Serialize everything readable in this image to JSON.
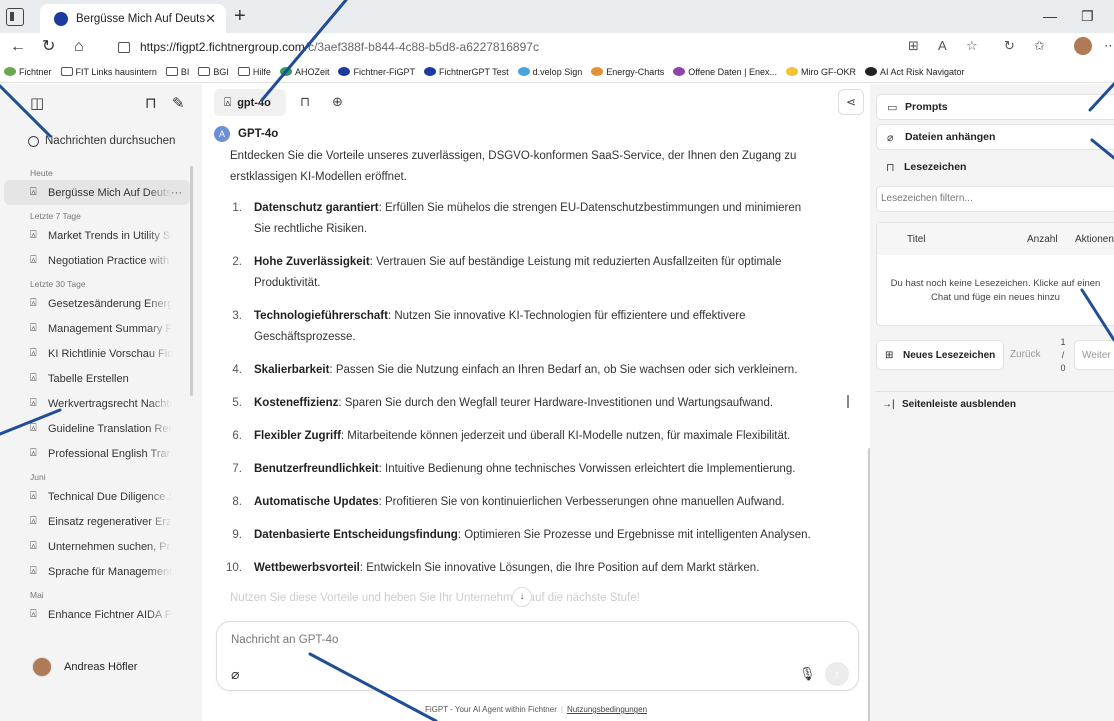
{
  "browser": {
    "tab_title": "Bergüsse Mich Auf Deutsch",
    "url_host": "https://figpt2.fichtnergroup.com",
    "url_path": "/c/3aef388f-b844-4c88-b5d8-a6227816897c"
  },
  "bookmarks": [
    {
      "label": "Fichtner",
      "color": "#6aa84f"
    },
    {
      "label": "FIT Links hausintern",
      "color": ""
    },
    {
      "label": "BI",
      "color": ""
    },
    {
      "label": "BGI",
      "color": ""
    },
    {
      "label": "Hilfe",
      "color": ""
    },
    {
      "label": "AHOZeit",
      "color": "#2e9c5c"
    },
    {
      "label": "Fichtner-FiGPT",
      "color": "#1d3b9e"
    },
    {
      "label": "FichtnerGPT Test",
      "color": "#1d3b9e"
    },
    {
      "label": "d.velop Sign",
      "color": "#4aa3df"
    },
    {
      "label": "Energy-Charts",
      "color": "#e69138"
    },
    {
      "label": "Offene Daten | Enex...",
      "color": "#8e44ad"
    },
    {
      "label": "Miro GF-OKR",
      "color": "#f1c232"
    },
    {
      "label": "AI Act Risk Navigator",
      "color": "#222222"
    }
  ],
  "sidebar": {
    "search_placeholder": "Nachrichten durchsuchen",
    "groups": [
      {
        "label": "Heute",
        "items": [
          {
            "title": "Bergüsse Mich Auf Deutsch",
            "active": true
          }
        ]
      },
      {
        "label": "Letzte 7 Tage",
        "items": [
          {
            "title": "Market Trends in Utility Sector"
          },
          {
            "title": "Negotiation Practice with AI"
          }
        ]
      },
      {
        "label": "Letzte 30 Tage",
        "items": [
          {
            "title": "Gesetzesänderung Energiewende"
          },
          {
            "title": "Management Summary Fichtner"
          },
          {
            "title": "KI Richtlinie Vorschau Fichtner"
          },
          {
            "title": "Tabelle Erstellen"
          },
          {
            "title": "Werkvertragsrecht Nachteile"
          },
          {
            "title": "Guideline Translation Request"
          },
          {
            "title": "Professional English Translation"
          }
        ]
      },
      {
        "label": "Juni",
        "items": [
          {
            "title": "Technical Due Diligence Struktur"
          },
          {
            "title": "Einsatz regenerativer Erzeugung"
          },
          {
            "title": "Unternehmen suchen, Präsentation"
          },
          {
            "title": "Sprache für Management Summary"
          }
        ]
      },
      {
        "label": "Mai",
        "items": [
          {
            "title": "Enhance Fichtner AIDA Product"
          }
        ]
      }
    ],
    "user_name": "Andreas Höfler"
  },
  "main": {
    "model_label": "gpt-4o",
    "assistant_name": "GPT-4o",
    "intro": "Entdecken Sie die Vorteile unseres zuverlässigen, DSGVO-konformen SaaS-Service, der Ihnen den Zugang zu erstklassigen KI-Modellen eröffnet.",
    "points": [
      {
        "n": "1.",
        "title": "Datenschutz garantiert",
        "text": ": Erfüllen Sie mühelos die strengen EU-Datenschutzbestimmungen und minimieren Sie rechtliche Risiken."
      },
      {
        "n": "2.",
        "title": "Hohe Zuverlässigkeit",
        "text": ": Vertrauen Sie auf beständige Leistung mit reduzierten Ausfallzeiten für optimale Produktivität."
      },
      {
        "n": "3.",
        "title": "Technologieführerschaft",
        "text": ": Nutzen Sie innovative KI-Technologien für effizientere und effektivere Geschäftsprozesse."
      },
      {
        "n": "4.",
        "title": "Skalierbarkeit",
        "text": ": Passen Sie die Nutzung einfach an Ihren Bedarf an, ob Sie wachsen oder sich verkleinern."
      },
      {
        "n": "5.",
        "title": "Kosteneffizienz",
        "text": ": Sparen Sie durch den Wegfall teurer Hardware-Investitionen und Wartungsaufwand."
      },
      {
        "n": "6.",
        "title": "Flexibler Zugriff",
        "text": ": Mitarbeitende können jederzeit und überall KI-Modelle nutzen, für maximale Flexibilität."
      },
      {
        "n": "7.",
        "title": "Benutzerfreundlichkeit",
        "text": ": Intuitive Bedienung ohne technisches Vorwissen erleichtert die Implementierung."
      },
      {
        "n": "8.",
        "title": "Automatische Updates",
        "text": ": Profitieren Sie von kontinuierlichen Verbesserungen ohne manuellen Aufwand."
      },
      {
        "n": "9.",
        "title": "Datenbasierte Entscheidungsfindung",
        "text": ": Optimieren Sie Prozesse und Ergebnisse mit intelligenten Analysen."
      },
      {
        "n": "10.",
        "title": "Wettbewerbsvorteil",
        "text": ": Entwickeln Sie innovative Lösungen, die Ihre Position auf dem Markt stärken."
      }
    ],
    "trailing_text": "Nutzen Sie diese Vorteile und heben Sie Ihr Unternehmen auf die nächste Stufe!",
    "composer_placeholder": "Nachricht an GPT-4o",
    "footer_text": "FiGPT - Your AI Agent within Fichtner",
    "footer_link": "Nutzungsbedingungen"
  },
  "right_panel": {
    "prompts": "Prompts",
    "attach": "Dateien anhängen",
    "bookmarks": "Lesezeichen",
    "filter_placeholder": "Lesezeichen filtern...",
    "col_title": "Titel",
    "col_count": "Anzahl",
    "col_actions": "Aktionen",
    "empty_text": "Du hast noch keine Lesezeichen. Klicke auf einen Chat und füge ein neues hinzu",
    "new_bookmark": "Neues Lesezeichen",
    "back": "Zurück",
    "page_current": "1",
    "page_sep": "/",
    "page_total": "0",
    "next": "Weiter",
    "hide_sidebar": "Seitenleiste ausblenden"
  },
  "colors": {
    "annotation_arrow": "#1f4e96",
    "accent": "#6d8ed8"
  }
}
